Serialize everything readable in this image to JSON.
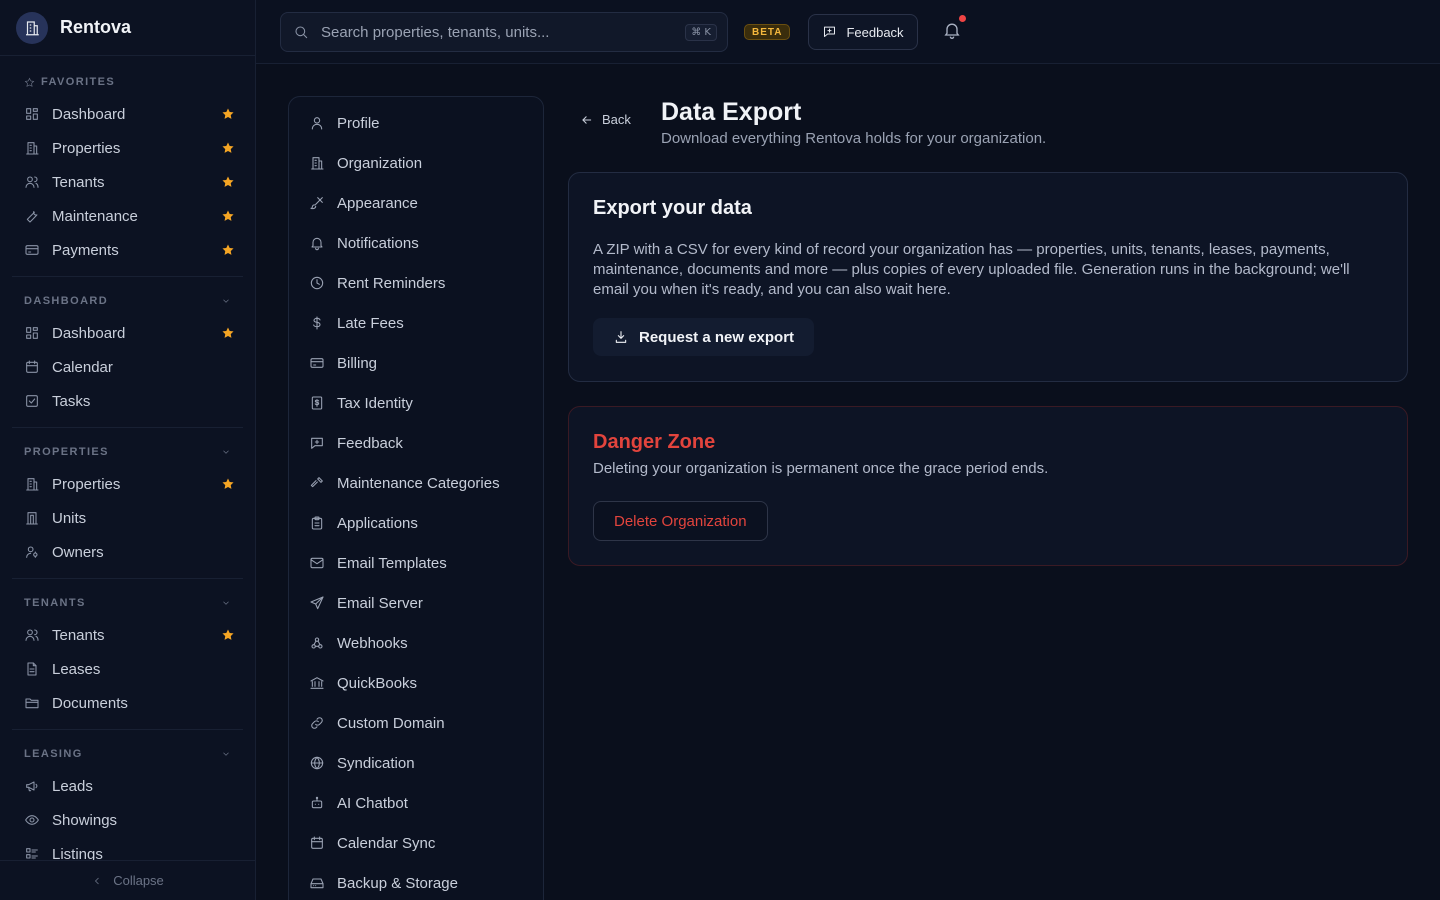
{
  "app": {
    "name": "Rentova"
  },
  "colors": {
    "accent_star": "#f5a524",
    "danger": "#e2443d",
    "beta": "#f5b83d",
    "notification_dot": "#ef4444"
  },
  "sidebar": {
    "favorites_label": "FAVORITES",
    "favorites": [
      {
        "label": "Dashboard",
        "icon": "dashboard-icon"
      },
      {
        "label": "Properties",
        "icon": "building-icon"
      },
      {
        "label": "Tenants",
        "icon": "users-icon"
      },
      {
        "label": "Maintenance",
        "icon": "wrench-icon"
      },
      {
        "label": "Payments",
        "icon": "card-icon"
      }
    ],
    "sections": [
      {
        "label": "DASHBOARD",
        "items": [
          {
            "label": "Dashboard",
            "icon": "dashboard-icon",
            "starred": true
          },
          {
            "label": "Calendar",
            "icon": "calendar-icon",
            "starred": false
          },
          {
            "label": "Tasks",
            "icon": "checkbox-icon",
            "starred": false
          }
        ]
      },
      {
        "label": "PROPERTIES",
        "items": [
          {
            "label": "Properties",
            "icon": "building-icon",
            "starred": true
          },
          {
            "label": "Units",
            "icon": "door-icon",
            "starred": false
          },
          {
            "label": "Owners",
            "icon": "owner-icon",
            "starred": false
          }
        ]
      },
      {
        "label": "TENANTS",
        "items": [
          {
            "label": "Tenants",
            "icon": "users-icon",
            "starred": true
          },
          {
            "label": "Leases",
            "icon": "file-icon",
            "starred": false
          },
          {
            "label": "Documents",
            "icon": "folder-icon",
            "starred": false
          }
        ]
      },
      {
        "label": "LEASING",
        "items": [
          {
            "label": "Leads",
            "icon": "megaphone-icon",
            "starred": false
          },
          {
            "label": "Showings",
            "icon": "eye-icon",
            "starred": false
          },
          {
            "label": "Listings",
            "icon": "list-icon",
            "starred": false
          }
        ]
      }
    ],
    "collapse_label": "Collapse"
  },
  "topbar": {
    "search_placeholder": "Search properties, tenants, units...",
    "shortcut": "⌘ K",
    "beta_label": "BETA",
    "feedback_label": "Feedback"
  },
  "settings_nav": [
    {
      "label": "Profile",
      "icon": "user-icon"
    },
    {
      "label": "Organization",
      "icon": "building-icon"
    },
    {
      "label": "Appearance",
      "icon": "brush-icon"
    },
    {
      "label": "Notifications",
      "icon": "bell-icon"
    },
    {
      "label": "Rent Reminders",
      "icon": "clock-icon"
    },
    {
      "label": "Late Fees",
      "icon": "dollar-icon"
    },
    {
      "label": "Billing",
      "icon": "card-icon"
    },
    {
      "label": "Tax Identity",
      "icon": "tax-icon"
    },
    {
      "label": "Feedback",
      "icon": "message-icon"
    },
    {
      "label": "Maintenance Categories",
      "icon": "hammer-icon"
    },
    {
      "label": "Applications",
      "icon": "clipboard-icon"
    },
    {
      "label": "Email Templates",
      "icon": "mail-icon"
    },
    {
      "label": "Email Server",
      "icon": "send-icon"
    },
    {
      "label": "Webhooks",
      "icon": "webhook-icon"
    },
    {
      "label": "QuickBooks",
      "icon": "bank-icon"
    },
    {
      "label": "Custom Domain",
      "icon": "link-icon"
    },
    {
      "label": "Syndication",
      "icon": "globe-icon"
    },
    {
      "label": "AI Chatbot",
      "icon": "bot-icon"
    },
    {
      "label": "Calendar Sync",
      "icon": "calendar-icon"
    },
    {
      "label": "Backup & Storage",
      "icon": "drive-icon"
    }
  ],
  "main": {
    "back_label": "Back",
    "title": "Data Export",
    "subtitle": "Download everything Rentova holds for your organization.",
    "export_card": {
      "title": "Export your data",
      "description": "A ZIP with a CSV for every kind of record your organization has — properties, units, tenants, leases, payments, maintenance, documents and more — plus copies of every uploaded file. Generation runs in the background; we'll email you when it's ready, and you can also wait here.",
      "button_label": "Request a new export"
    },
    "danger_card": {
      "title": "Danger Zone",
      "description": "Deleting your organization is permanent once the grace period ends.",
      "button_label": "Delete Organization"
    }
  }
}
